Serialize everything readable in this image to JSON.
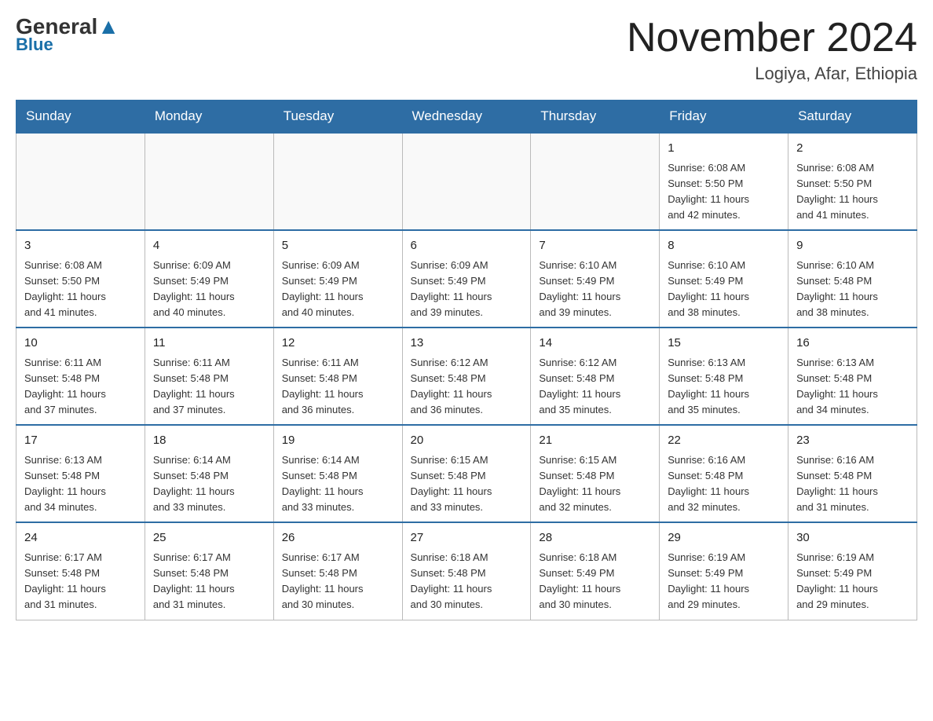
{
  "header": {
    "logo_general": "General",
    "logo_blue": "Blue",
    "month_title": "November 2024",
    "location": "Logiya, Afar, Ethiopia"
  },
  "weekdays": [
    "Sunday",
    "Monday",
    "Tuesday",
    "Wednesday",
    "Thursday",
    "Friday",
    "Saturday"
  ],
  "weeks": [
    {
      "days": [
        {
          "num": "",
          "info": ""
        },
        {
          "num": "",
          "info": ""
        },
        {
          "num": "",
          "info": ""
        },
        {
          "num": "",
          "info": ""
        },
        {
          "num": "",
          "info": ""
        },
        {
          "num": "1",
          "info": "Sunrise: 6:08 AM\nSunset: 5:50 PM\nDaylight: 11 hours\nand 42 minutes."
        },
        {
          "num": "2",
          "info": "Sunrise: 6:08 AM\nSunset: 5:50 PM\nDaylight: 11 hours\nand 41 minutes."
        }
      ]
    },
    {
      "days": [
        {
          "num": "3",
          "info": "Sunrise: 6:08 AM\nSunset: 5:50 PM\nDaylight: 11 hours\nand 41 minutes."
        },
        {
          "num": "4",
          "info": "Sunrise: 6:09 AM\nSunset: 5:49 PM\nDaylight: 11 hours\nand 40 minutes."
        },
        {
          "num": "5",
          "info": "Sunrise: 6:09 AM\nSunset: 5:49 PM\nDaylight: 11 hours\nand 40 minutes."
        },
        {
          "num": "6",
          "info": "Sunrise: 6:09 AM\nSunset: 5:49 PM\nDaylight: 11 hours\nand 39 minutes."
        },
        {
          "num": "7",
          "info": "Sunrise: 6:10 AM\nSunset: 5:49 PM\nDaylight: 11 hours\nand 39 minutes."
        },
        {
          "num": "8",
          "info": "Sunrise: 6:10 AM\nSunset: 5:49 PM\nDaylight: 11 hours\nand 38 minutes."
        },
        {
          "num": "9",
          "info": "Sunrise: 6:10 AM\nSunset: 5:48 PM\nDaylight: 11 hours\nand 38 minutes."
        }
      ]
    },
    {
      "days": [
        {
          "num": "10",
          "info": "Sunrise: 6:11 AM\nSunset: 5:48 PM\nDaylight: 11 hours\nand 37 minutes."
        },
        {
          "num": "11",
          "info": "Sunrise: 6:11 AM\nSunset: 5:48 PM\nDaylight: 11 hours\nand 37 minutes."
        },
        {
          "num": "12",
          "info": "Sunrise: 6:11 AM\nSunset: 5:48 PM\nDaylight: 11 hours\nand 36 minutes."
        },
        {
          "num": "13",
          "info": "Sunrise: 6:12 AM\nSunset: 5:48 PM\nDaylight: 11 hours\nand 36 minutes."
        },
        {
          "num": "14",
          "info": "Sunrise: 6:12 AM\nSunset: 5:48 PM\nDaylight: 11 hours\nand 35 minutes."
        },
        {
          "num": "15",
          "info": "Sunrise: 6:13 AM\nSunset: 5:48 PM\nDaylight: 11 hours\nand 35 minutes."
        },
        {
          "num": "16",
          "info": "Sunrise: 6:13 AM\nSunset: 5:48 PM\nDaylight: 11 hours\nand 34 minutes."
        }
      ]
    },
    {
      "days": [
        {
          "num": "17",
          "info": "Sunrise: 6:13 AM\nSunset: 5:48 PM\nDaylight: 11 hours\nand 34 minutes."
        },
        {
          "num": "18",
          "info": "Sunrise: 6:14 AM\nSunset: 5:48 PM\nDaylight: 11 hours\nand 33 minutes."
        },
        {
          "num": "19",
          "info": "Sunrise: 6:14 AM\nSunset: 5:48 PM\nDaylight: 11 hours\nand 33 minutes."
        },
        {
          "num": "20",
          "info": "Sunrise: 6:15 AM\nSunset: 5:48 PM\nDaylight: 11 hours\nand 33 minutes."
        },
        {
          "num": "21",
          "info": "Sunrise: 6:15 AM\nSunset: 5:48 PM\nDaylight: 11 hours\nand 32 minutes."
        },
        {
          "num": "22",
          "info": "Sunrise: 6:16 AM\nSunset: 5:48 PM\nDaylight: 11 hours\nand 32 minutes."
        },
        {
          "num": "23",
          "info": "Sunrise: 6:16 AM\nSunset: 5:48 PM\nDaylight: 11 hours\nand 31 minutes."
        }
      ]
    },
    {
      "days": [
        {
          "num": "24",
          "info": "Sunrise: 6:17 AM\nSunset: 5:48 PM\nDaylight: 11 hours\nand 31 minutes."
        },
        {
          "num": "25",
          "info": "Sunrise: 6:17 AM\nSunset: 5:48 PM\nDaylight: 11 hours\nand 31 minutes."
        },
        {
          "num": "26",
          "info": "Sunrise: 6:17 AM\nSunset: 5:48 PM\nDaylight: 11 hours\nand 30 minutes."
        },
        {
          "num": "27",
          "info": "Sunrise: 6:18 AM\nSunset: 5:48 PM\nDaylight: 11 hours\nand 30 minutes."
        },
        {
          "num": "28",
          "info": "Sunrise: 6:18 AM\nSunset: 5:49 PM\nDaylight: 11 hours\nand 30 minutes."
        },
        {
          "num": "29",
          "info": "Sunrise: 6:19 AM\nSunset: 5:49 PM\nDaylight: 11 hours\nand 29 minutes."
        },
        {
          "num": "30",
          "info": "Sunrise: 6:19 AM\nSunset: 5:49 PM\nDaylight: 11 hours\nand 29 minutes."
        }
      ]
    }
  ]
}
